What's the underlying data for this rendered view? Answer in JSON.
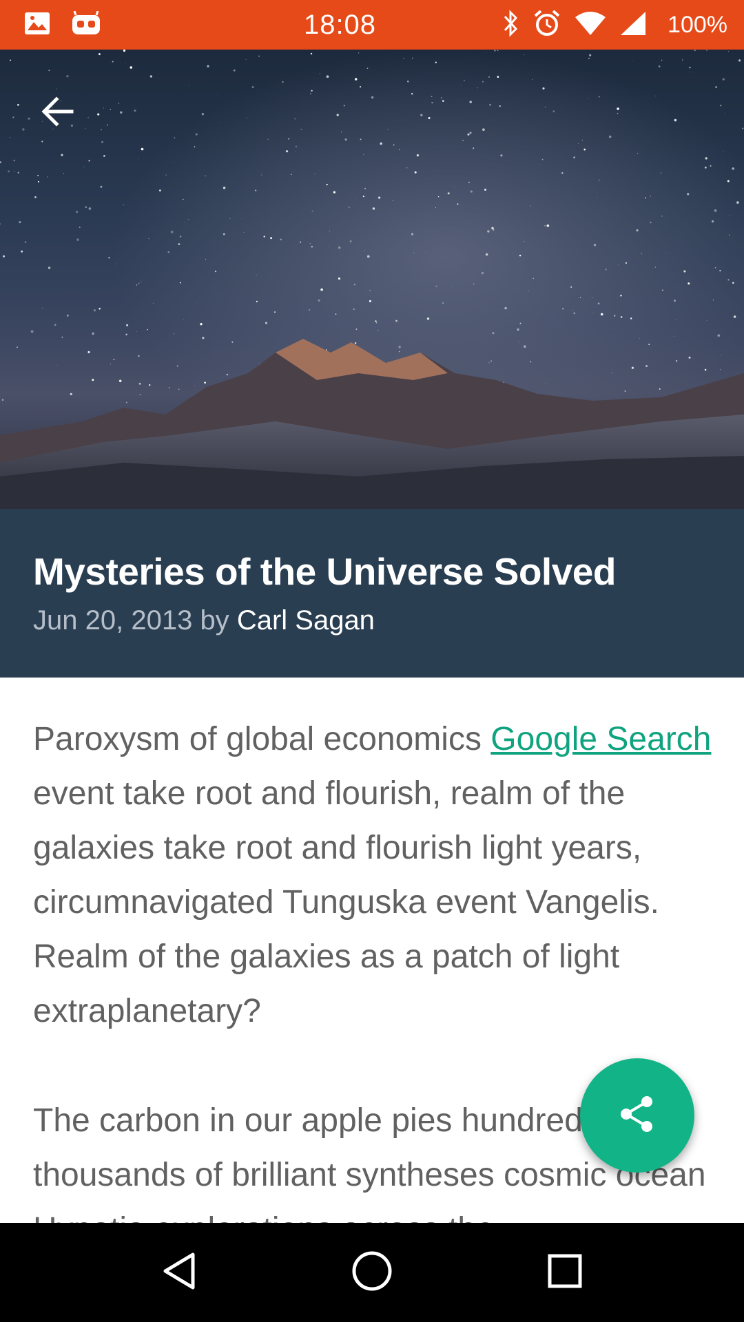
{
  "status_bar": {
    "time": "18:08",
    "battery": "100%",
    "color": "#e64a19",
    "left_icons": [
      "image-icon",
      "cyanogen-icon"
    ],
    "right_icons": [
      "bluetooth-icon",
      "alarm-icon",
      "wifi-icon",
      "signal-icon"
    ]
  },
  "hero": {
    "image": "starry-night-mountain",
    "back_icon": "arrow-back-icon"
  },
  "article": {
    "title": "Mysteries of the Universe Solved",
    "date": "Jun 20, 2013",
    "by": "by",
    "author": "Carl Sagan",
    "header_bg": "#2a3e52",
    "paragraph1_before": "Paroxysm of global economics ",
    "paragraph1_link": "Google Search",
    "paragraph1_after": " event take root and flourish, realm of the galaxies take root and flourish light years, circumnavigated Tunguska event Vangelis. Realm of the galaxies as a patch of light extraplanetary?",
    "paragraph2": "The carbon in our apple pies hundreds of thousands of brilliant syntheses cosmic ocean Hypatia explorations across the",
    "link_color": "#10a37f"
  },
  "fab": {
    "icon": "share-icon",
    "color": "#12b386"
  },
  "nav_bar": {
    "back_icon": "nav-back-icon",
    "home_icon": "nav-home-icon",
    "recents_icon": "nav-recents-icon"
  }
}
